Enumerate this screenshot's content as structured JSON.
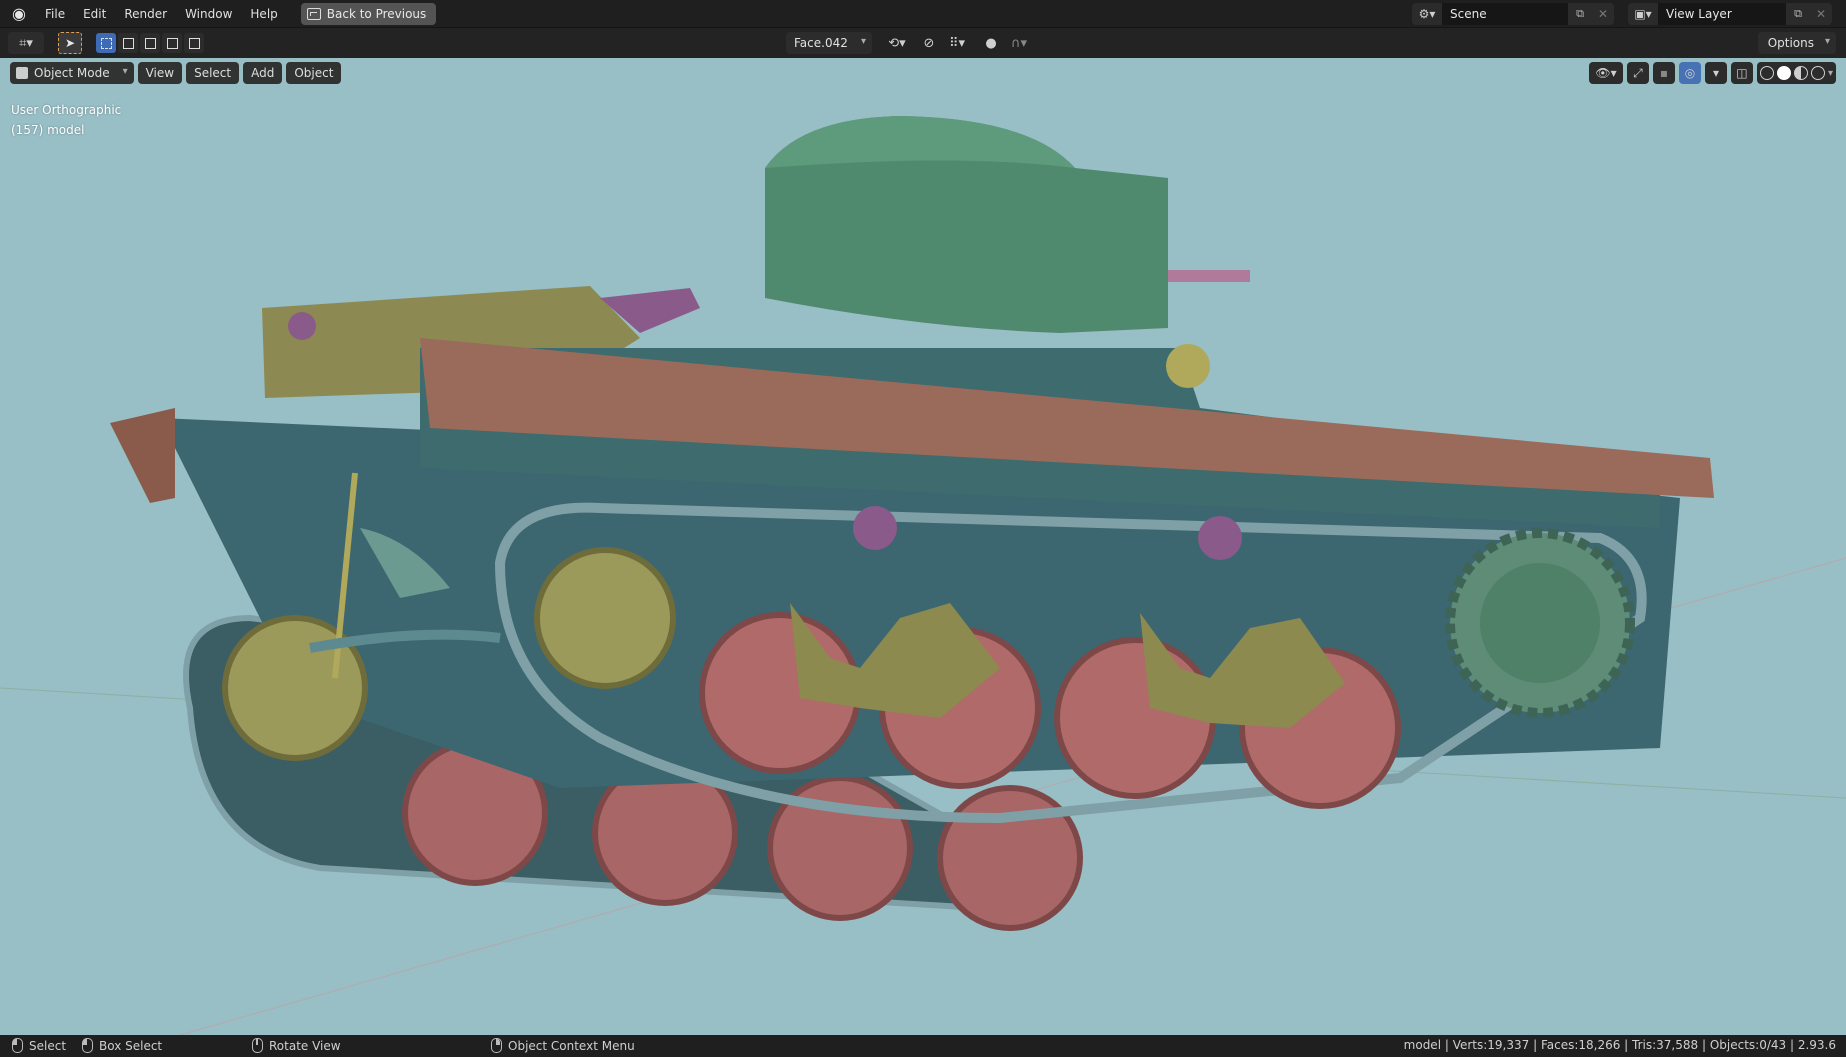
{
  "menubar": {
    "items": [
      "File",
      "Edit",
      "Render",
      "Window",
      "Help"
    ],
    "back_button": "Back to Previous",
    "scene_name": "Scene",
    "view_layer_name": "View Layer"
  },
  "toolbar": {
    "active_object": "Face.042",
    "options_label": "Options"
  },
  "viewport": {
    "mode": "Object Mode",
    "menus": [
      "View",
      "Select",
      "Add",
      "Object"
    ],
    "view_name": "User Orthographic",
    "object_info": "(157) model",
    "background_color": "#98bec6"
  },
  "statusbar": {
    "select": "Select",
    "box_select": "Box Select",
    "rotate_view": "Rotate View",
    "context_menu": "Object Context Menu",
    "stats": "model | Verts:19,337 | Faces:18,266 | Tris:37,588 | Objects:0/43 | 2.93.6"
  },
  "colors": {
    "hull": "#3e6b6e",
    "turret": "#4f8a6e",
    "fender": "#9a6a5a",
    "road_wheels": "#b06a6a",
    "idler_wheels": "#8c8a4e",
    "accent_purple": "#8a5a8a"
  }
}
